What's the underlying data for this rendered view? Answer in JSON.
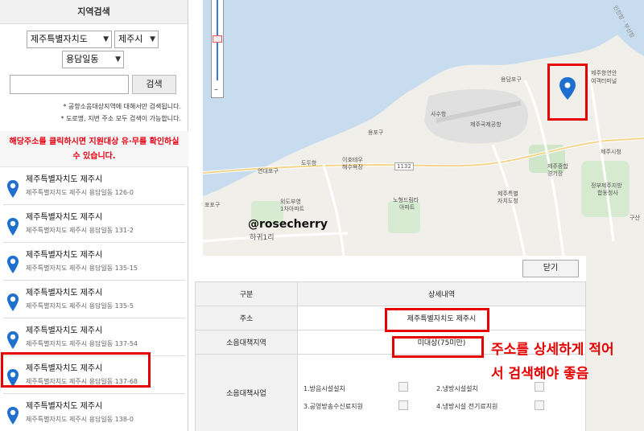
{
  "panel": {
    "title": "지역검색",
    "province": "제주특별자치도",
    "city": "제주시",
    "district": "용담일동",
    "search_value": "",
    "search_label": "검색",
    "note1": "* 공항소음대상지역에 대해서만 검색됩니다.",
    "note2": "* 도로명, 지번 주소 모두 검색이 가능합니다.",
    "alert": "해당주소를 클릭하시면 지원대상 유·무를 확인하실 수 있습니다."
  },
  "results": [
    {
      "title": "제주특별자치도 제주시",
      "sub": "제주특별자치도 제주시 용담일동 126-0"
    },
    {
      "title": "제주특별자치도 제주시",
      "sub": "제주특별자치도 제주시 용담일동 131-2"
    },
    {
      "title": "제주특별자치도 제주시",
      "sub": "제주특별자치도 제주시 용담일동 135-15"
    },
    {
      "title": "제주특별자치도 제주시",
      "sub": "제주특별자치도 제주시 용담일동 135-5"
    },
    {
      "title": "제주특별자치도 제주시",
      "sub": "제주특별자치도 제주시 용담일동 137-54"
    },
    {
      "title": "제주특별자치도 제주시",
      "sub": "제주특별자치도 제주시 용담일동 137-68"
    },
    {
      "title": "제주특별자치도 제주시",
      "sub": "제주특별자치도 제주시 용담일동 138-0"
    }
  ],
  "map": {
    "watermark": "@rosecherry",
    "labels": {
      "l1": "제주항연안",
      "l2": "여객터미널",
      "l3": "용담포구",
      "l4": "사수항",
      "l5": "제주국제공항",
      "l6": "용포구",
      "l7": "도두항",
      "l8": "연대포구",
      "l9": "이호테우",
      "l10": "해수욕장",
      "l11": "외도부영",
      "l12": "1차아파트",
      "l13": "노형드림타",
      "l14": "아파트",
      "l15": "제주종합",
      "l16": "경기장",
      "l17": "제주특별",
      "l18": "자치도청",
      "l19": "정부제주지방",
      "l20": "합동청사",
      "l21": "제주시청",
      "l22": "포포구",
      "l23": "하귀1리",
      "l24": "구산",
      "l25": "1132",
      "l26": "인천항 · 부산항"
    }
  },
  "detail": {
    "close_label": "닫기",
    "col1_header": "구분",
    "col2_header": "상세내역",
    "row_address_label": "주소",
    "row_address_value": "제주특별자치도 제주시",
    "row_zone_label": "소음대책지역",
    "row_zone_value": "미대상(75미만)",
    "row_project_label": "소음대책사업",
    "opt1": "1.방음시설설치",
    "opt2": "2.냉방시설설치",
    "opt3": "3.공영방송수신료지원",
    "opt4": "4.냉방시설 전기료지원"
  },
  "annotation": {
    "line1": "주소를 상세하게 적어",
    "line2": "서 검색해야 좋음"
  },
  "colors": {
    "accent_red": "#e60000",
    "pin_blue": "#1e6fd0",
    "alert_red": "#e60012"
  }
}
